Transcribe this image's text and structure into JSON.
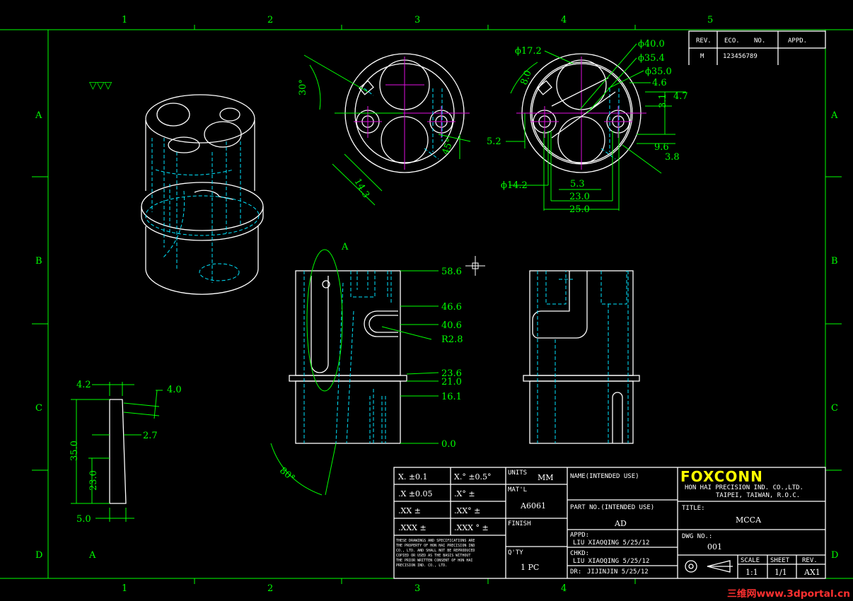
{
  "grid": {
    "columns": [
      "1",
      "2",
      "3",
      "4",
      "5"
    ],
    "rows": [
      "A",
      "B",
      "C",
      "D"
    ]
  },
  "views": {
    "detail_label_top": "A",
    "detail_label_bottom": "A",
    "top_view_left": {
      "angle_30": "30°",
      "dim_14_3": "14.3",
      "angle_45": "45°"
    },
    "top_view_right": {
      "d17_2": "ϕ17.2",
      "d8_0": "8.0",
      "d40_0": "ϕ40.0",
      "d35_4": "ϕ35.4",
      "d35_0": "ϕ35.0",
      "d4_6": "4.6",
      "d4_7": "4.7",
      "d3_1": "3.1",
      "d5_2": "5.2",
      "d9_6": "9.6",
      "d3_8": "3.8",
      "d14_2": "ϕ14.2",
      "d5_3": "5.3",
      "d23_0": "23.0",
      "d25_0": "25.0"
    },
    "front_view": {
      "h58_6": "58.6",
      "h46_6": "46.6",
      "h40_6": "40.6",
      "r2_8": "R2.8",
      "h23_6": "23.6",
      "h21_0": "21.0",
      "h16_1": "16.1",
      "h0_0": "0.0",
      "angle_80": "80°"
    },
    "detail_view": {
      "d4_2": "4.2",
      "d4_0": "4.0",
      "d2_7": "2.7",
      "d35_0": "35.0",
      "d23_0": "23.0",
      "d5_0": "5.0"
    }
  },
  "revision_block": {
    "rev_header": "REV.",
    "eco_header": "ECO.",
    "no_header": "NO.",
    "appd_header": "APPD.",
    "rev": "M",
    "eco_no": "123456789"
  },
  "title_block": {
    "tol_x": "X.  ±0.1",
    "tol_x_deg": "X.°  ±0.5°",
    "tol_xx": ".X  ±0.05",
    "tol_xx_deg": ".X°  ±",
    "tol_xxx": ".XX  ±",
    "tol_xxx_deg": ".XX°  ±",
    "tol_xxxx": ".XXX  ±",
    "tol_xxxx_deg": ".XXX °  ±",
    "notice": [
      "THESE DRAWINGS AND SPECIFICATIONS ARE",
      "THE PROPERTY OF HON HAI PRECISION IND",
      "CO., LTD. AND SHALL NOT BE REPRODUCED",
      "COPIED OR USED AS THE BASIS WITHOUT",
      "THE PRIOR WRITTEN CONSENT OF HON HAI",
      "PRECISION IND. CO., LTD."
    ],
    "units_label": "UNITS",
    "units_value": "MM",
    "material_label": "MAT'L",
    "material_value": "A6061",
    "finish_label": "FINISH",
    "qty_label": "Q'TY",
    "qty_value": "1  PC",
    "name_label": "NAME(INTENDED USE)",
    "part_no_label": "PART NO.(INTENDED USE)",
    "part_no_value": "AD",
    "appd_label": "APPD:",
    "appd_value": "LIU XIAOQING 5/25/12",
    "chkd_label": "CHKD:",
    "chkd_value": "LIU XIAOQING 5/25/12",
    "dr_label": "DR:",
    "dr_value": "JIJINJIN 5/25/12",
    "company_logo": "FOXCONN",
    "company_name": "HON HAI PRECISION IND. CO.,LTD.",
    "company_address": "TAIPEI, TAIWAN, R.O.C.",
    "title_label": "TITLE:",
    "title_value": "MCCA",
    "dwg_no_label": "DWG NO.:",
    "dwg_no_value": "001",
    "scale_label": "SCALE",
    "scale_value": "1:1",
    "sheet_label": "SHEET",
    "sheet_value": "1/1",
    "rev_label": "REV.",
    "rev_value": "AX1"
  },
  "surface_symbol": "▽▽▽",
  "watermark": "三维网www.3dportal.cn",
  "colors": {
    "background": "#000000",
    "dimension": "#00ff00",
    "outline": "#ffffff",
    "hidden": "#00e5ff",
    "centerline": "#e010e0",
    "logo": "#ffff00"
  }
}
